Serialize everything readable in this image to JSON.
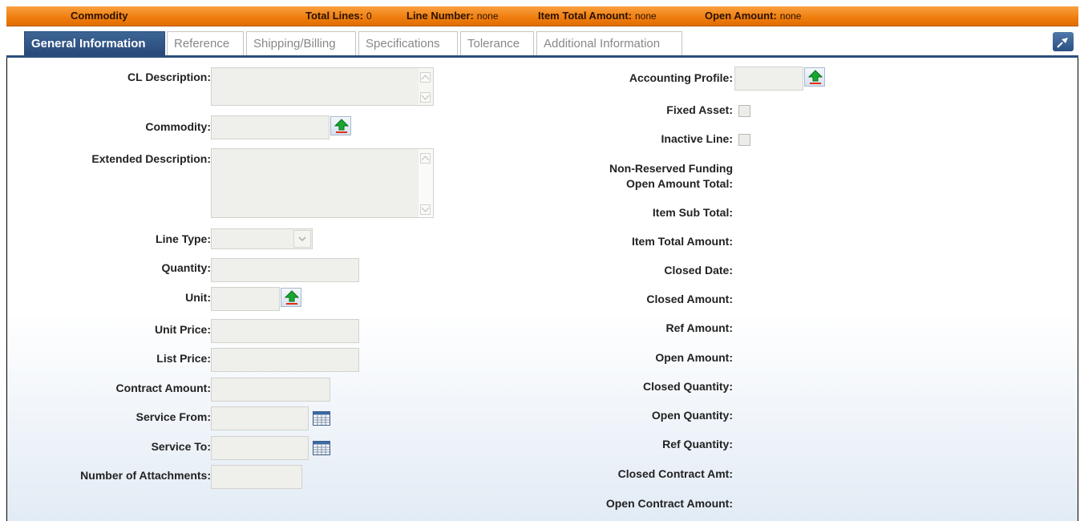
{
  "header": {
    "title": "Commodity",
    "total_lines_label": "Total Lines:",
    "total_lines_value": "0",
    "line_number_label": "Line Number:",
    "line_number_value": "none",
    "item_total_label": "Item Total Amount:",
    "item_total_value": "none",
    "open_amount_label": "Open Amount:",
    "open_amount_value": "none"
  },
  "tabs": [
    {
      "label": "General Information"
    },
    {
      "label": "Reference"
    },
    {
      "label": "Shipping/Billing"
    },
    {
      "label": "Specifications"
    },
    {
      "label": "Tolerance"
    },
    {
      "label": "Additional Information"
    }
  ],
  "left_form": {
    "cl_description": "CL Description:",
    "commodity": "Commodity:",
    "extended_description": "Extended Description:",
    "line_type": "Line Type:",
    "quantity": "Quantity:",
    "unit": "Unit:",
    "unit_price": "Unit Price:",
    "list_price": "List Price:",
    "contract_amount": "Contract Amount:",
    "service_from": "Service From:",
    "service_to": "Service To:",
    "number_of_attachments": "Number of Attachments:"
  },
  "right_form": {
    "accounting_profile": "Accounting Profile:",
    "fixed_asset": "Fixed Asset:",
    "inactive_line": "Inactive Line:",
    "non_reserved_1": "Non-Reserved Funding",
    "non_reserved_2": "Open Amount Total:",
    "item_sub_total": "Item Sub Total:",
    "item_total_amount": "Item Total Amount:",
    "closed_date": "Closed Date:",
    "closed_amount": "Closed Amount:",
    "ref_amount": "Ref Amount:",
    "open_amount": "Open Amount:",
    "closed_quantity": "Closed Quantity:",
    "open_quantity": "Open Quantity:",
    "ref_quantity": "Ref Quantity:",
    "closed_contract_amt": "Closed Contract Amt:",
    "open_contract_amount": "Open Contract Amount:"
  },
  "colors": {
    "header_orange": "#f07f10",
    "tab_active": "#2d5283",
    "field_bg": "#efefeb"
  }
}
